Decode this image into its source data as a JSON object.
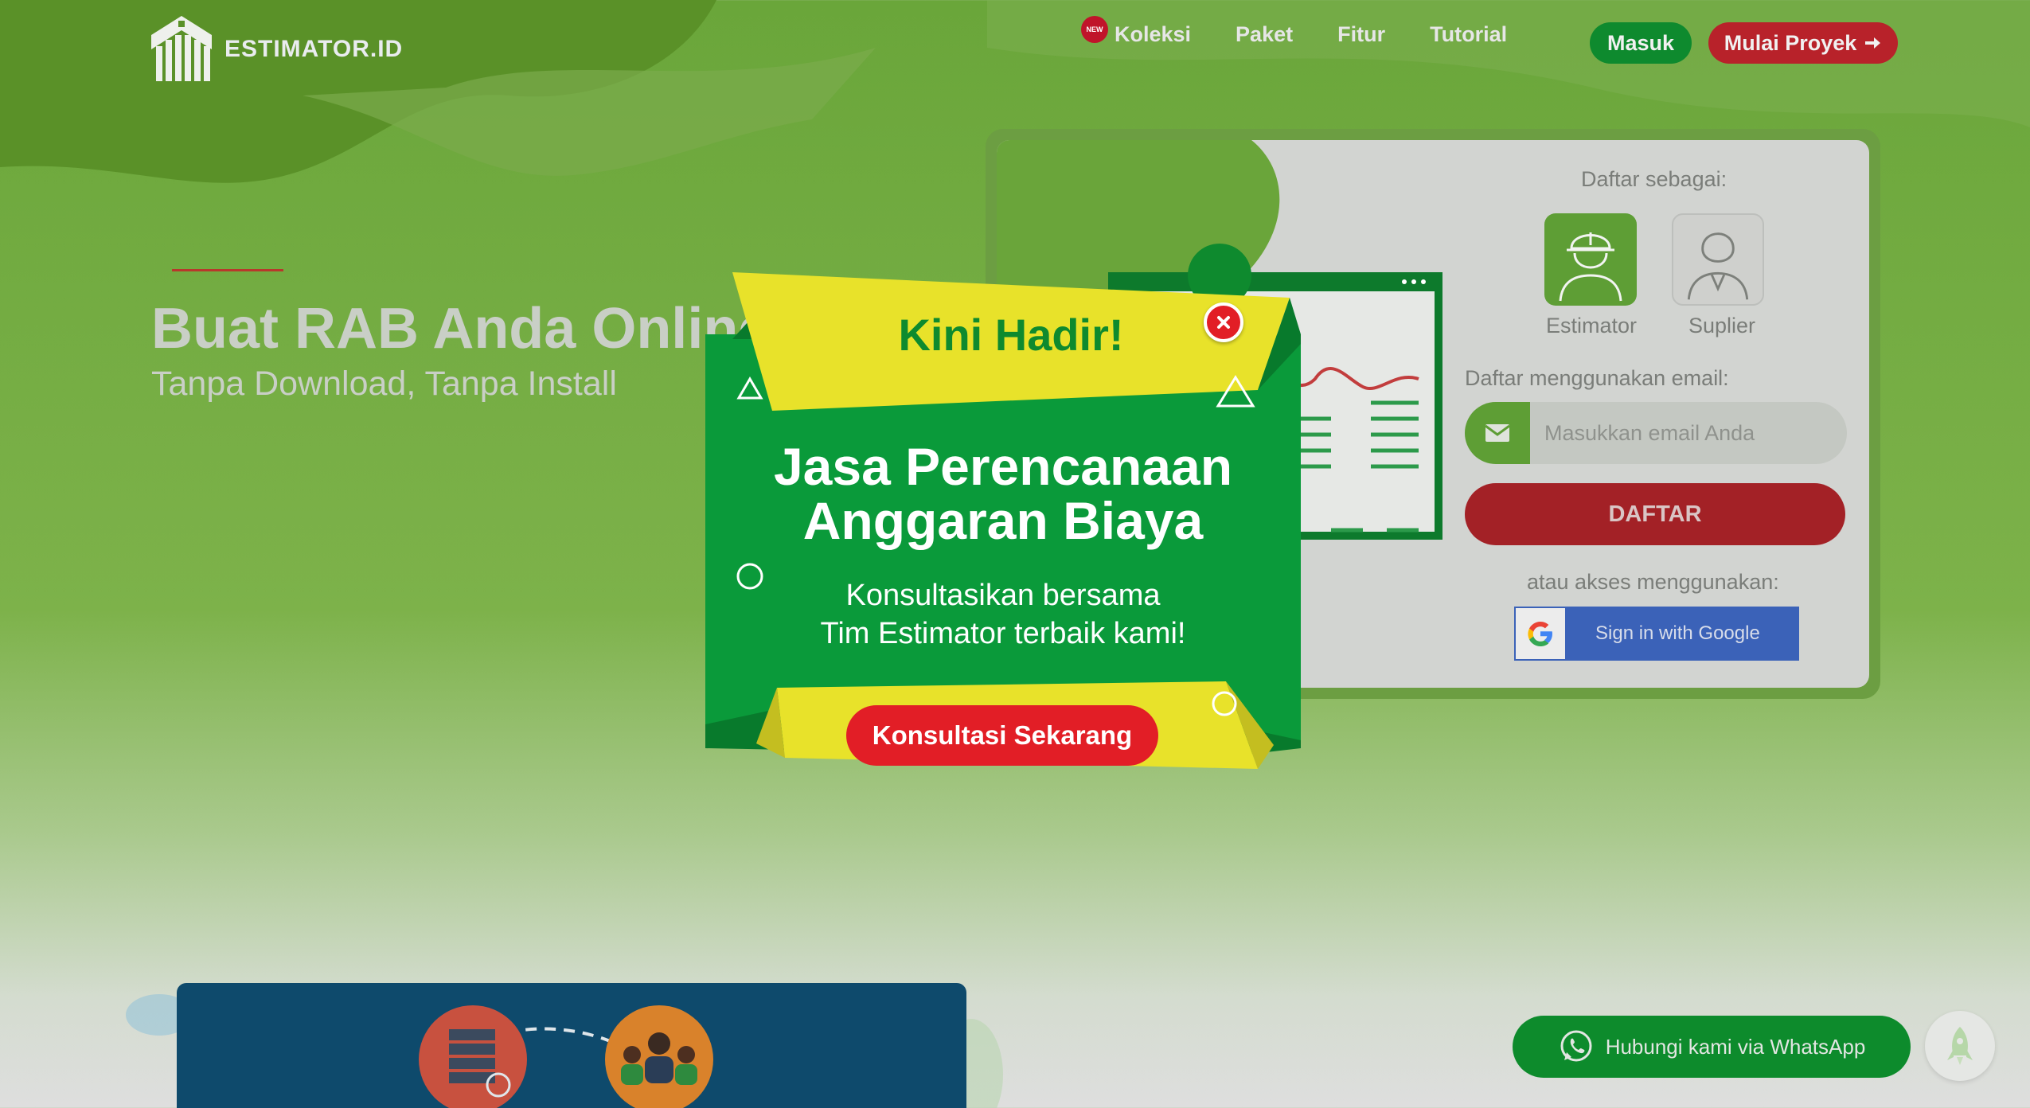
{
  "brand": {
    "name": "ESTIMATOR.ID"
  },
  "nav": {
    "new_badge": "NEW",
    "items": [
      {
        "label": "Koleksi"
      },
      {
        "label": "Paket"
      },
      {
        "label": "Fitur"
      },
      {
        "label": "Tutorial"
      }
    ],
    "login_label": "Masuk",
    "start_label": "Mulai Proyek"
  },
  "hero": {
    "title": "Buat RAB Anda Online",
    "subtitle": "Tanpa Download, Tanpa Install"
  },
  "register": {
    "register_as_label": "Daftar sebagai:",
    "roles": [
      {
        "label": "Estimator",
        "icon": "engineer-icon"
      },
      {
        "label": "Suplier",
        "icon": "supplier-icon"
      }
    ],
    "email_label": "Daftar menggunakan email:",
    "email_placeholder": "Masukkan email Anda",
    "email_value": "",
    "submit_label": "DAFTAR",
    "alt_label": "atau akses menggunakan:",
    "google_label": "Sign in with Google"
  },
  "whatsapp": {
    "label": "Hubungi kami via WhatsApp"
  },
  "modal": {
    "kicker": "Kini Hadir!",
    "title_line1": "Jasa Perencanaan",
    "title_line2": "Anggaran Biaya",
    "text_line1": "Konsultasikan bersama",
    "text_line2": "Tim Estimator terbaik kami!",
    "cta_label": "Konsultasi Sekarang"
  },
  "colors": {
    "primary_green": "#0e8a2e",
    "accent_red": "#e21e26",
    "banner_yellow": "#e8e22a",
    "page_green": "#6aa63a"
  }
}
